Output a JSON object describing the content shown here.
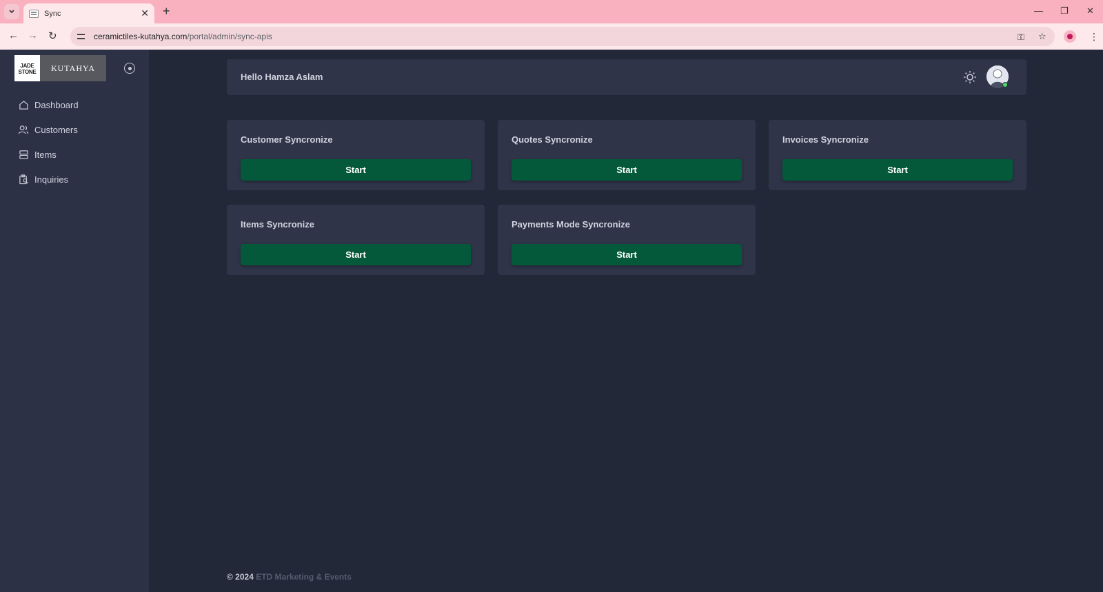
{
  "browser": {
    "tab_title": "Sync",
    "url_host": "ceramictiles-kutahya.com",
    "url_path": "/portal/admin/sync-apis"
  },
  "sidebar": {
    "logo_left": "JADE STONE",
    "logo_right": "KUTAHYA",
    "items": [
      {
        "label": "Dashboard",
        "icon": "home-icon"
      },
      {
        "label": "Customers",
        "icon": "users-icon"
      },
      {
        "label": "Items",
        "icon": "database-icon"
      },
      {
        "label": "Inquiries",
        "icon": "clipboard-search-icon"
      }
    ]
  },
  "header": {
    "greeting": "Hello Hamza Aslam",
    "status_color": "#4cd964"
  },
  "cards": [
    {
      "title": "Customer Syncronize",
      "button": "Start"
    },
    {
      "title": "Quotes Syncronize",
      "button": "Start"
    },
    {
      "title": "Invoices Syncronize",
      "button": "Start"
    },
    {
      "title": "Items Syncronize",
      "button": "Start"
    },
    {
      "title": "Payments Mode Syncronize",
      "button": "Start"
    }
  ],
  "footer": {
    "copyright": "© 2024",
    "brand": "ETD Marketing & Events"
  },
  "colors": {
    "accent_button": "#04593a",
    "background": "#232838",
    "panel": "#2f3449",
    "sidebar": "#2c3146",
    "browser_frame": "#f9b1bf"
  }
}
